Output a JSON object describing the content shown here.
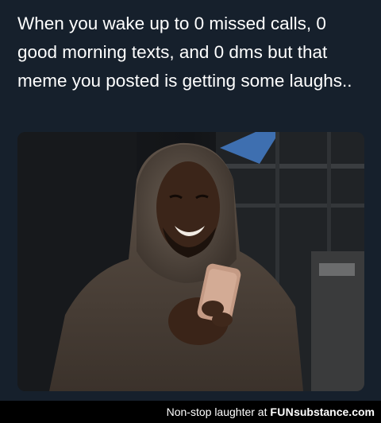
{
  "post": {
    "text": "When you wake up to 0 missed calls, 0 good morning texts, and 0 dms but that meme you posted is getting some laughs.."
  },
  "footer": {
    "caption": "Non-stop laughter at ",
    "brand_fun": "FUN",
    "brand_rest": "substance.com"
  },
  "colors": {
    "background": "#16202c",
    "footer_background": "#000000",
    "text": "#ffffff"
  }
}
